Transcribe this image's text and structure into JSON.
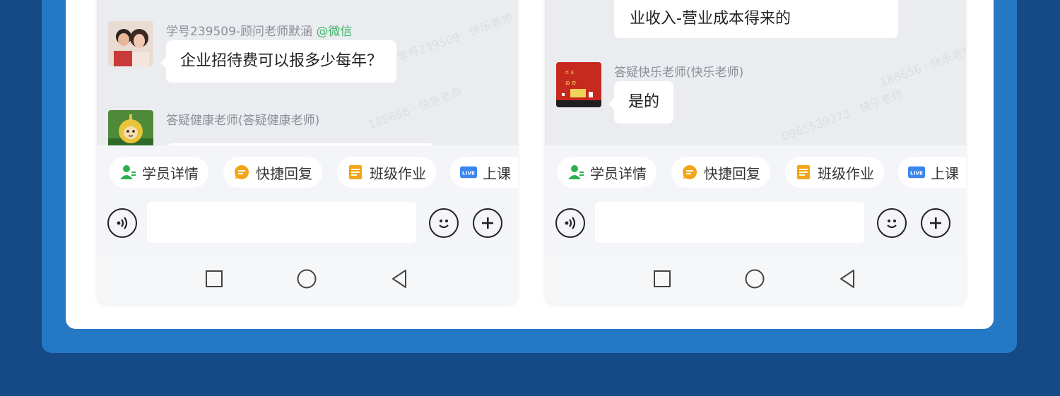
{
  "left_phone": {
    "messages": [
      {
        "sender": "学号239509-顾问老师默涵",
        "sender_tag": "@微信",
        "text": "企业招待费可以报多少每年？"
      },
      {
        "sender": "答疑健康老师(答疑健康老师)",
        "text": ""
      }
    ],
    "quick_actions": [
      {
        "label": "学员详情",
        "icon": "user-detail-icon"
      },
      {
        "label": "快捷回复",
        "icon": "quick-reply-icon"
      },
      {
        "label": "班级作业",
        "icon": "homework-icon"
      },
      {
        "label": "上课",
        "icon": "live-icon"
      }
    ],
    "live_badge": "LIVE"
  },
  "right_phone": {
    "top_bubble_lines": [
      "业收入-营业成本得来的"
    ],
    "messages": [
      {
        "sender": "答疑快乐老师(快乐老师)",
        "text": "是的"
      }
    ],
    "quick_actions": [
      {
        "label": "学员详情",
        "icon": "user-detail-icon"
      },
      {
        "label": "快捷回复",
        "icon": "quick-reply-icon"
      },
      {
        "label": "班级作业",
        "icon": "homework-icon"
      },
      {
        "label": "上课",
        "icon": "live-icon"
      }
    ],
    "live_badge": "LIVE"
  },
  "colors": {
    "page_bg": "#164a86",
    "frame_blue": "#2578c4",
    "card_white": "#ffffff",
    "chat_bg": "#ebecf0",
    "green": "#3fb66a",
    "orange": "#f2a516",
    "live_blue": "#3a86f0"
  }
}
